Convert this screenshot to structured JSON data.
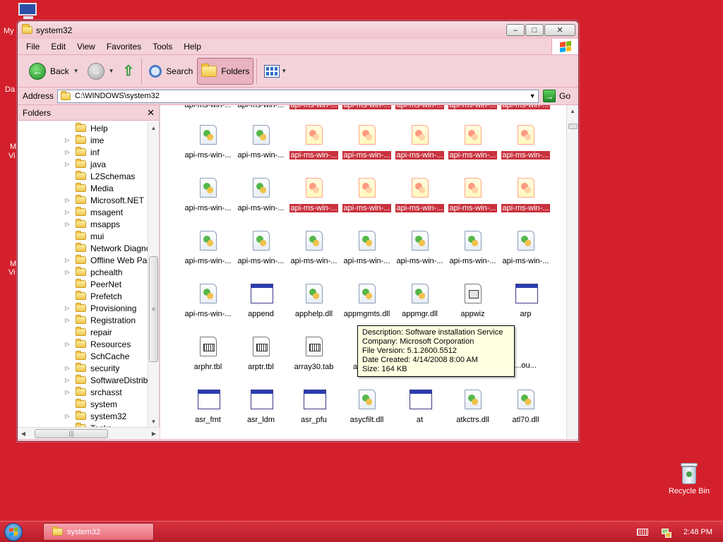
{
  "desktop": {
    "fragments": [
      "My",
      "Da",
      "M",
      "Vi",
      "M",
      "Vi"
    ],
    "recycle_bin": "Recycle Bin"
  },
  "window": {
    "title": "system32",
    "buttons": {
      "minimize": "–",
      "maximize": "□",
      "close": "✕"
    }
  },
  "menu": [
    "File",
    "Edit",
    "View",
    "Favorites",
    "Tools",
    "Help"
  ],
  "toolbar": {
    "back": "Back",
    "search": "Search",
    "folders": "Folders"
  },
  "address": {
    "label": "Address",
    "path": "C:\\WINDOWS\\system32",
    "go": "Go"
  },
  "folders_pane": {
    "title": "Folders",
    "close": "✕",
    "items": [
      {
        "label": "Help",
        "expandable": false
      },
      {
        "label": "ime",
        "expandable": true
      },
      {
        "label": "inf",
        "expandable": true
      },
      {
        "label": "java",
        "expandable": true
      },
      {
        "label": "L2Schemas",
        "expandable": false
      },
      {
        "label": "Media",
        "expandable": false
      },
      {
        "label": "Microsoft.NET",
        "expandable": true
      },
      {
        "label": "msagent",
        "expandable": true
      },
      {
        "label": "msapps",
        "expandable": true
      },
      {
        "label": "mui",
        "expandable": false
      },
      {
        "label": "Network Diagnc",
        "expandable": false
      },
      {
        "label": "Offline Web Pag",
        "expandable": true
      },
      {
        "label": "pchealth",
        "expandable": true
      },
      {
        "label": "PeerNet",
        "expandable": false
      },
      {
        "label": "Prefetch",
        "expandable": false
      },
      {
        "label": "Provisioning",
        "expandable": true
      },
      {
        "label": "Registration",
        "expandable": true
      },
      {
        "label": "repair",
        "expandable": false
      },
      {
        "label": "Resources",
        "expandable": true
      },
      {
        "label": "SchCache",
        "expandable": false
      },
      {
        "label": "security",
        "expandable": true
      },
      {
        "label": "SoftwareDistribu",
        "expandable": true
      },
      {
        "label": "srchasst",
        "expandable": true
      },
      {
        "label": "system",
        "expandable": false
      },
      {
        "label": "system32",
        "expandable": true
      },
      {
        "label": "Tasks",
        "expandable": false
      }
    ]
  },
  "files": {
    "rows": [
      [
        {
          "label": "api-ms-win-...",
          "icon": "dll",
          "selected": false
        },
        {
          "label": "api-ms-win-...",
          "icon": "dll",
          "selected": false
        },
        {
          "label": "api-ms-win-...",
          "icon": "dll",
          "selected": true
        },
        {
          "label": "api-ms-win-...",
          "icon": "dll",
          "selected": true
        },
        {
          "label": "api-ms-win-...",
          "icon": "dll",
          "selected": true
        },
        {
          "label": "api-ms-win-...",
          "icon": "dll",
          "selected": true
        },
        {
          "label": "api-ms-win-...",
          "icon": "dll",
          "selected": true
        }
      ],
      [
        {
          "label": "api-ms-win-...",
          "icon": "dll",
          "selected": false
        },
        {
          "label": "api-ms-win-...",
          "icon": "dll",
          "selected": false
        },
        {
          "label": "api-ms-win-...",
          "icon": "dll",
          "selected": true
        },
        {
          "label": "api-ms-win-...",
          "icon": "dll",
          "selected": true
        },
        {
          "label": "api-ms-win-...",
          "icon": "dll",
          "selected": true
        },
        {
          "label": "api-ms-win-...",
          "icon": "dll",
          "selected": true
        },
        {
          "label": "api-ms-win-...",
          "icon": "dll",
          "selected": true
        }
      ],
      [
        {
          "label": "api-ms-win-...",
          "icon": "dll",
          "selected": false
        },
        {
          "label": "api-ms-win-...",
          "icon": "dll",
          "selected": false
        },
        {
          "label": "api-ms-win-...",
          "icon": "dll",
          "selected": false
        },
        {
          "label": "api-ms-win-...",
          "icon": "dll",
          "selected": false
        },
        {
          "label": "api-ms-win-...",
          "icon": "dll",
          "selected": false
        },
        {
          "label": "api-ms-win-...",
          "icon": "dll",
          "selected": false
        },
        {
          "label": "api-ms-win-...",
          "icon": "dll",
          "selected": false
        }
      ],
      [
        {
          "label": "api-ms-win-...",
          "icon": "dll",
          "selected": false
        },
        {
          "label": "append",
          "icon": "app",
          "selected": false
        },
        {
          "label": "apphelp.dll",
          "icon": "dll",
          "selected": false
        },
        {
          "label": "appmgmts.dll",
          "icon": "dll",
          "selected": false
        },
        {
          "label": "appmgr.dll",
          "icon": "dll",
          "selected": false
        },
        {
          "label": "appwiz",
          "icon": "cpl",
          "selected": false
        },
        {
          "label": "arp",
          "icon": "app",
          "selected": false
        }
      ],
      [
        {
          "label": "arphr.tbl",
          "icon": "tbl",
          "selected": false
        },
        {
          "label": "arptr.tbl",
          "icon": "tbl",
          "selected": false
        },
        {
          "label": "array30.tab",
          "icon": "tbl",
          "selected": false
        },
        {
          "label": "arrayhw",
          "icon": "tbl",
          "selected": false
        },
        {
          "label": "",
          "icon": "none",
          "selected": false
        },
        {
          "label": "",
          "icon": "none",
          "selected": false
        },
        {
          "label": "...ou...",
          "icon": "none",
          "selected": false
        }
      ],
      [
        {
          "label": "asr_fmt",
          "icon": "app",
          "selected": false
        },
        {
          "label": "asr_ldm",
          "icon": "app",
          "selected": false
        },
        {
          "label": "asr_pfu",
          "icon": "app",
          "selected": false
        },
        {
          "label": "asycfilt.dll",
          "icon": "dll",
          "selected": false
        },
        {
          "label": "at",
          "icon": "app",
          "selected": false
        },
        {
          "label": "atkctrs.dll",
          "icon": "dll",
          "selected": false
        },
        {
          "label": "atl70.dll",
          "icon": "dll",
          "selected": false
        }
      ]
    ]
  },
  "tooltip": {
    "description": "Description: Software installation Service",
    "company": "Company: Microsoft Corporation",
    "version": "File Version: 5.1.2600.5512",
    "created": "Date Created: 4/14/2008 8:00 AM",
    "size": "Size: 164 KB"
  },
  "taskbar": {
    "task": "system32",
    "clock": "2:48 PM"
  }
}
